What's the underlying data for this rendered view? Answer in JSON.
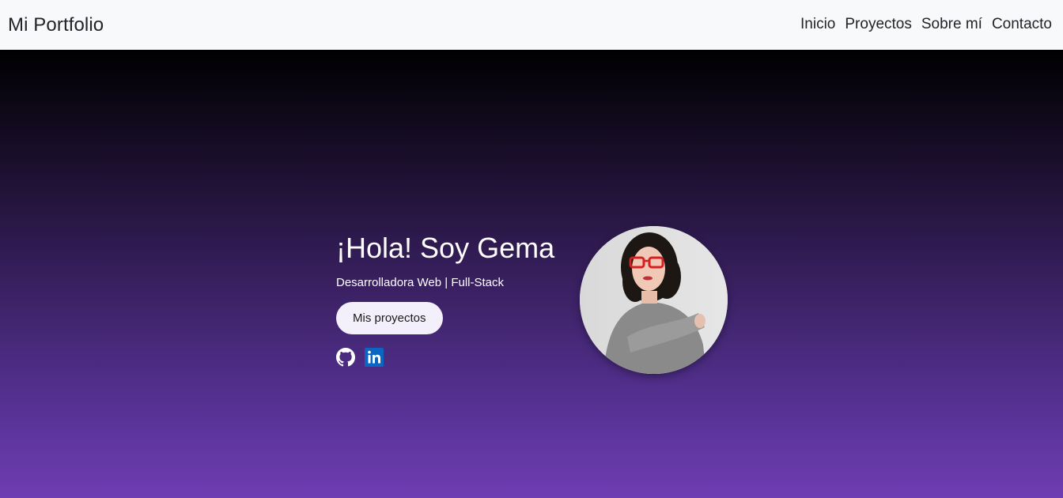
{
  "navbar": {
    "brand": "Mi Portfolio",
    "links": [
      "Inicio",
      "Proyectos",
      "Sobre mí",
      "Contacto"
    ]
  },
  "hero": {
    "title": "¡Hola! Soy Gema",
    "subtitle": "Desarrolladora Web | Full-Stack",
    "button_label": "Mis proyectos",
    "social_icons": [
      "github-icon",
      "linkedin-icon"
    ]
  },
  "colors": {
    "navbar_bg": "#f8f9fa",
    "gradient_top": "#000000",
    "gradient_bottom": "#6f3db3",
    "button_bg": "#f3f0fb",
    "linkedin_blue": "#0a66c2"
  }
}
